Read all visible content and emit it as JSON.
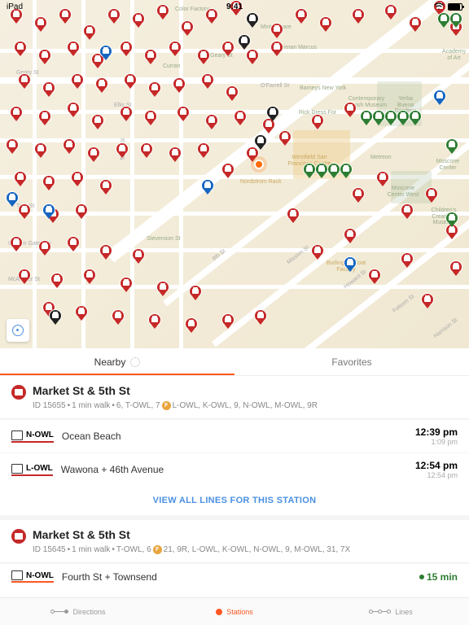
{
  "status": {
    "device": "iPad",
    "time": "9:41"
  },
  "map": {
    "roads": [
      "Geary St",
      "Ellis St",
      "Turk St",
      "Golden Gate Ave",
      "McAllister St",
      "Taylor St",
      "6th St",
      "O'Farrell St",
      "Mission St",
      "Howard St",
      "Folsom St",
      "Harrison St"
    ],
    "pois": [
      "Color Factory",
      "Curran",
      "Geary St",
      "Mint Square",
      "Neiman Marcus",
      "Barneys New York",
      "Contemporary Jewish Museum",
      "Yerba Buena Gardens",
      "Academy of Art",
      "Rick Dress For Less",
      "Westfield San Francisco Centre",
      "Nordstrom Rack",
      "Metreon",
      "Moscone Center West",
      "Moscone Center",
      "Children's Creativity Museum",
      "Stevenson St",
      "Burlington Coat Factory"
    ]
  },
  "tabs": {
    "nearby": "Nearby",
    "favorites": "Favorites"
  },
  "stations": [
    {
      "icon": "red",
      "name": "Market St & 5th  St",
      "meta_id": "ID 15655",
      "meta_walk": "1 min walk",
      "meta_lines": "6, T-OWL, 7",
      "meta_badge": "F",
      "meta_lines2": "L-OWL, K-OWL, 9, N-OWL, M-OWL, 9R",
      "lines": [
        {
          "badge": "N-OWL",
          "dest": "Ocean Beach",
          "time": "12:39 pm",
          "sub": "1:09 pm"
        },
        {
          "badge": "L-OWL",
          "dest": "Wawona + 46th Avenue",
          "time": "12:54 pm",
          "sub": "12:54 pm"
        }
      ],
      "view_all": "VIEW ALL LINES FOR THIS STATION"
    },
    {
      "icon": "red",
      "name": "Market St & 5th St",
      "meta_id": "ID 15645",
      "meta_walk": "1 min walk",
      "meta_lines": "T-OWL, 6",
      "meta_badge": "F",
      "meta_lines2": "21, 9R, L-OWL, K-OWL, N-OWL, 9, M-OWL, 31, 7X",
      "lines": [
        {
          "badge": "N-OWL",
          "dest": "Fourth St + Townsend",
          "time": "15 min",
          "live": true
        }
      ]
    }
  ],
  "nav": {
    "directions": "Directions",
    "stations": "Stations",
    "lines": "Lines"
  },
  "chart_data": {
    "type": "map",
    "center_label": "Westfield San Francisco Centre area",
    "pins_red": 120,
    "pins_green": 18,
    "pins_blue": 10,
    "pins_black": 6,
    "user_location": true
  }
}
